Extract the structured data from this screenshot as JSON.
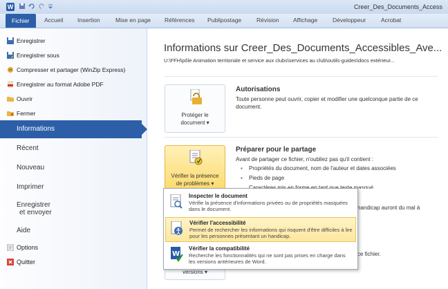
{
  "window": {
    "title": "Creer_Des_Documents_Access"
  },
  "ribbon": {
    "tabs": [
      "Fichier",
      "Accueil",
      "Insertion",
      "Mise en page",
      "Références",
      "Publipostage",
      "Révision",
      "Affichage",
      "Développeur",
      "Acrobat"
    ]
  },
  "sidebar": {
    "top_items": [
      "Enregistrer",
      "Enregistrer sous",
      "Compresser et partager (WinZip Express)",
      "Enregistrer au format Adobe PDF",
      "Ouvrir",
      "Fermer"
    ],
    "selected": "Informations",
    "items": [
      "Récent",
      "Nouveau",
      "Imprimer"
    ],
    "save_send": [
      "Enregistrer",
      "et envoyer"
    ],
    "help": "Aide",
    "options": "Options",
    "quit": "Quitter"
  },
  "main": {
    "title": "Informations sur Creer_Des_Documents_Accessibles_Ave...",
    "path": "U:\\FFH\\pôle Animation territoriale et service aux clubs\\services au club\\outils-guides\\docs extérieur...",
    "permissions": {
      "button_lines": [
        "Protéger le",
        "document ▾"
      ],
      "title": "Autorisations",
      "text": "Toute personne peut ouvrir, copier et modifier une quelconque partie de ce document."
    },
    "prepare": {
      "button_lines": [
        "Vérifier la présence",
        "de problèmes ▾"
      ],
      "title": "Préparer pour le partage",
      "text": "Avant de partager ce fichier, n'oubliez pas qu'il contient :",
      "bullets": [
        "Propriétés du document, nom de l'auteur et dates associées",
        "Pieds de page",
        "Caractères mis en forme en tant que texte masqué"
      ],
      "partial_right": "handicap auront du mal à"
    },
    "versions": {
      "button_line": "versions ▾",
      "partial_right": "ce fichier."
    }
  },
  "dropdown": {
    "items": [
      {
        "title": "Inspecter le document",
        "desc": "Vérifie la présence d'informations privées ou de propriétés masquées dans le document."
      },
      {
        "title": "Vérifier l'accessibilité",
        "desc": "Permet de rechercher les informations qui risquent d'être difficiles à lire pour les personnes présentant un handicap."
      },
      {
        "title": "Vérifier la compatibilité",
        "desc": "Recherche les fonctionnalités qui ne sont pas prises en charge dans les versions antérieures de Word."
      }
    ]
  },
  "colors": {
    "accent": "#2c5fa8",
    "highlight": "#fcd96a"
  }
}
